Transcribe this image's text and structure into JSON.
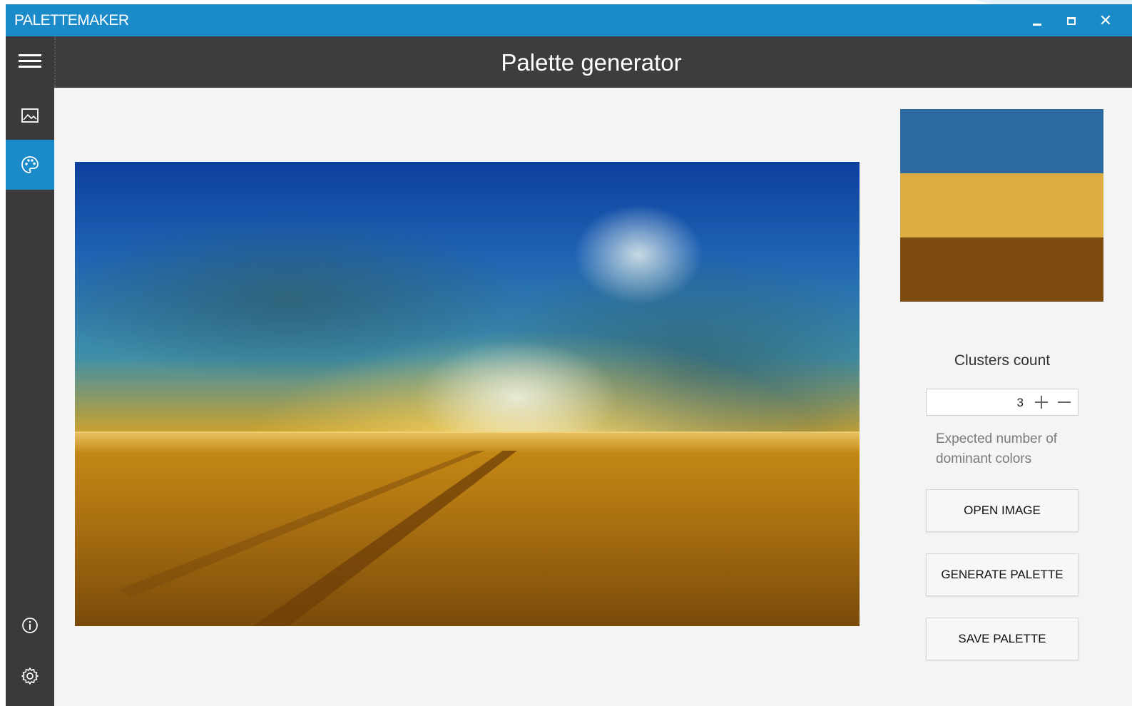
{
  "window": {
    "title": "PALETTEMAKER",
    "minimize_label": "",
    "maximize_label": "",
    "close_label": "✕"
  },
  "sidebar": {
    "items": [
      {
        "icon": "hamburger-menu-icon"
      },
      {
        "icon": "image-icon"
      },
      {
        "icon": "palette-icon",
        "active": true
      },
      {
        "icon": "info-icon"
      },
      {
        "icon": "gear-icon"
      }
    ]
  },
  "header": {
    "title": "Palette generator"
  },
  "palette": {
    "colors": [
      "#2d6a9f",
      "#ddad43",
      "#7d4c0e"
    ]
  },
  "controls": {
    "clusters_label": "Clusters count",
    "clusters_value": "3",
    "hint": "Expected number of dominant colors",
    "open_image": "OPEN IMAGE",
    "generate_palette": "GENERATE PALETTE",
    "save_palette": "SAVE PALETTE"
  },
  "colors": {
    "accent": "#1a8bc8",
    "sidebar": "#3a3a3a",
    "header": "#3d3d3d",
    "background": "#f4f4f4"
  }
}
